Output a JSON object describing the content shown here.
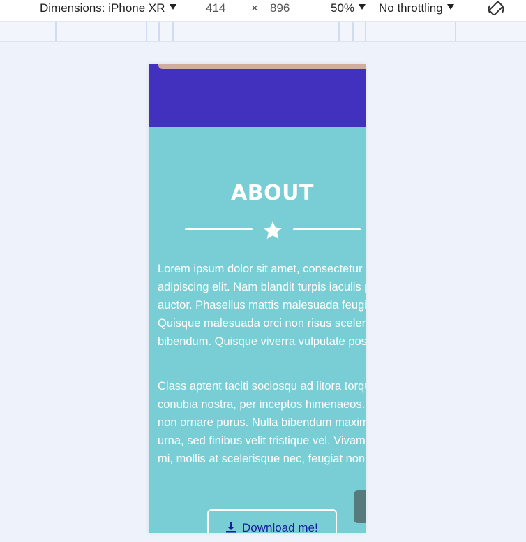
{
  "devtools": {
    "device_label": "Dimensions: iPhone XR",
    "width": "414",
    "times": "×",
    "height": "896",
    "zoom": "50%",
    "throttling": "No throttling",
    "rotate_icon": "rotate-icon"
  },
  "page": {
    "about_title": "ABOUT",
    "divider_icon": "star-icon",
    "paragraph_1": "Lorem ipsum dolor sit amet, consectetur adipiscing elit. Nam blandit turpis iaculis pharetra auctor. Phasellus mattis malesuada feugiat. Quisque malesuada orci non risus scelerisque bibendum. Quisque viverra vulputate posuere.",
    "paragraph_2": "Class aptent taciti sociosqu ad litora torquent per conubia nostra, per inceptos himenaeos. Nulla non ornare purus. Nulla bibendum maximus urna, sed finibus velit tristique vel. Vivamus ante mi, mollis at scelerisque nec, feugiat non dui.",
    "download_label": "Download me!",
    "download_icon": "download-icon"
  },
  "colors": {
    "hero": "#4131be",
    "about_bg": "#79cdd4",
    "accent_bar": "#d0ad9d",
    "button_text": "#121f9a"
  }
}
